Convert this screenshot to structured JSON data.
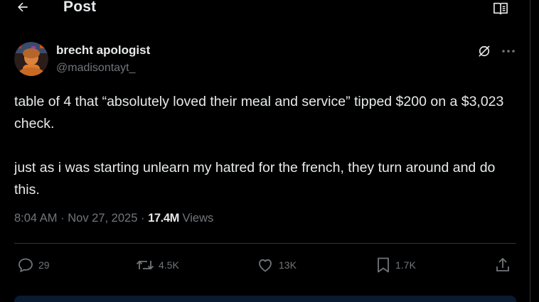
{
  "header": {
    "title": "Post",
    "back_icon": "arrow-left-icon",
    "reader_icon": "book-open-icon"
  },
  "author": {
    "display_name": "brecht apologist",
    "handle": "@madisontayt_"
  },
  "tweet": {
    "paragraph_1": "table of 4 that “absolutely loved their meal and service” tipped $200 on a $3,023 check.",
    "paragraph_2": "just as i was starting unlearn my hatred for the french, they turn around and do this."
  },
  "meta": {
    "time": "8:04 AM",
    "separator": "·",
    "date": "Nov 27, 2025",
    "views_count": "17.4M",
    "views_label": "Views"
  },
  "actions": {
    "replies": "29",
    "reposts": "4.5K",
    "likes": "13K",
    "bookmarks": "1.7K"
  },
  "colors": {
    "background": "#000000",
    "text": "#e7e9ea",
    "muted": "#71767b",
    "divider": "#2f3336"
  }
}
